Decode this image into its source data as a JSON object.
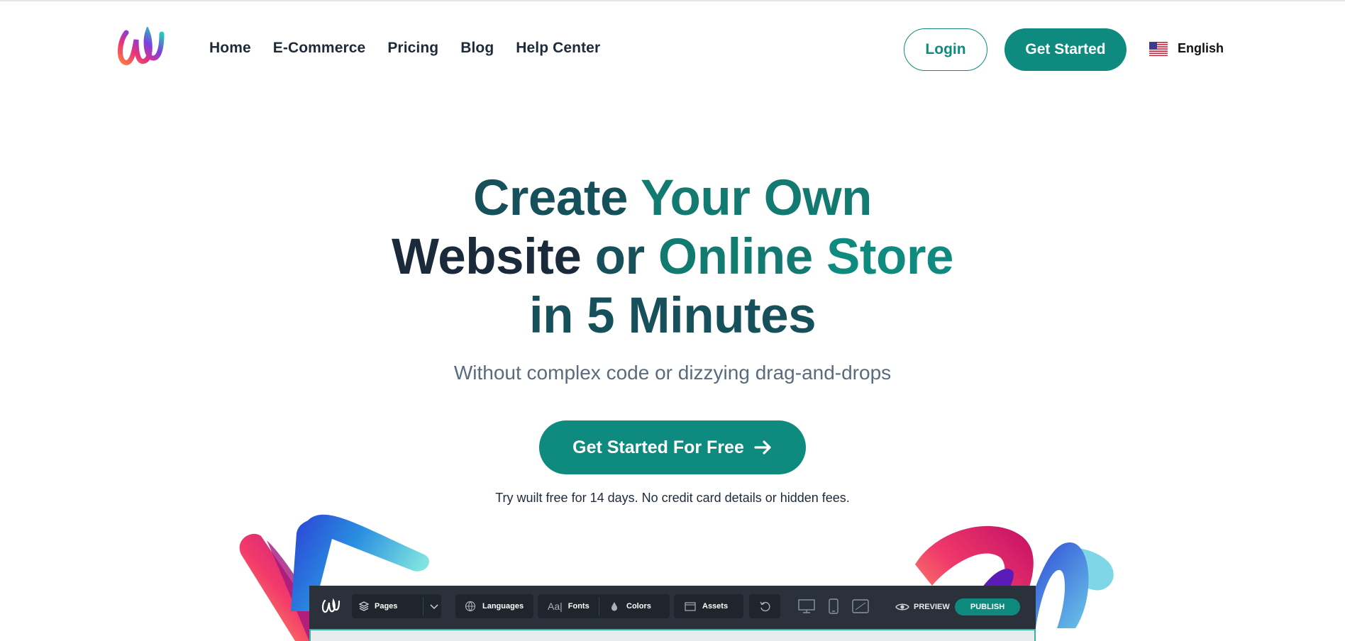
{
  "nav": {
    "menu": [
      "Home",
      "E-Commerce",
      "Pricing",
      "Blog",
      "Help Center"
    ],
    "login_label": "Login",
    "get_started_label": "Get Started",
    "language_label": "English"
  },
  "hero": {
    "title_words": {
      "line1_a": "Create",
      "line1_b": "Your",
      "line1_c": "Own",
      "line2_a": "Website",
      "line2_b": "or",
      "line2_c": "Online",
      "line2_d": "Store",
      "line3": "in 5 Minutes"
    },
    "subtitle": "Without complex code or dizzying drag-and-drops",
    "cta_label": "Get Started For Free",
    "trial_note": "Try wuilt free for 14 days. No credit card details or hidden fees."
  },
  "editor": {
    "pages_label": "Pages",
    "languages_label": "Languages",
    "fonts_label": "Fonts",
    "colors_label": "Colors",
    "assets_label": "Assets",
    "preview_label": "PREVIEW",
    "publish_label": "PUBLISH"
  },
  "colors": {
    "brand_teal": "#0f8a7f",
    "heading_dark": "#1b2a3a",
    "subtitle_gray": "#5a6b7d",
    "editor_bg": "#2a313a"
  },
  "icons": [
    "logo-w",
    "us-flag-icon",
    "arrow-right-icon",
    "layers-icon",
    "chevron-down-icon",
    "globe-icon",
    "fonts-icon",
    "droplet-icon",
    "folder-icon",
    "undo-icon",
    "desktop-icon",
    "mobile-icon",
    "tablet-icon",
    "eye-icon"
  ]
}
